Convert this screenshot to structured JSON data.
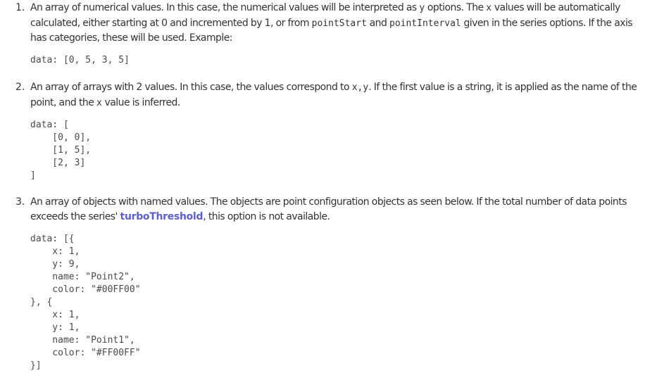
{
  "items": [
    {
      "number": "1.",
      "text_1": "An array of numerical values. In this case, the numerical values will be interpreted as ",
      "code_1": "y",
      "text_2": " options. The ",
      "code_2": "x",
      "text_3": " values will be automatically calculated, either starting at 0 and incremented by 1, or from ",
      "code_3": "pointStart",
      "text_4": " and ",
      "code_4": "pointInterval",
      "text_5": " given in the series options. If the axis has categories, these will be used. Example:",
      "code_block": "data: [0, 5, 3, 5]"
    },
    {
      "number": "2.",
      "text_1": "An array of arrays with 2 values. In this case, the values correspond to ",
      "code_1": "x,y",
      "text_2": ". If the first value is a string, it is applied as the name of the point, and the ",
      "code_2": "x",
      "text_3": " value is inferred.",
      "code_block": "data: [\n    [0, 0],\n    [1, 5],\n    [2, 3]\n]"
    },
    {
      "number": "3.",
      "text_1": "An array of objects with named values. The objects are point configuration objects as seen below. If the total number of data points exceeds the series' ",
      "link_text": "turboThreshold",
      "text_2": ", this option is not available.",
      "code_block": "data: [{\n    x: 1,\n    y: 9,\n    name: \"Point2\",\n    color: \"#00FF00\"\n}, {\n    x: 1,\n    y: 1,\n    name: \"Point1\",\n    color: \"#FF00FF\"\n}]"
    }
  ]
}
